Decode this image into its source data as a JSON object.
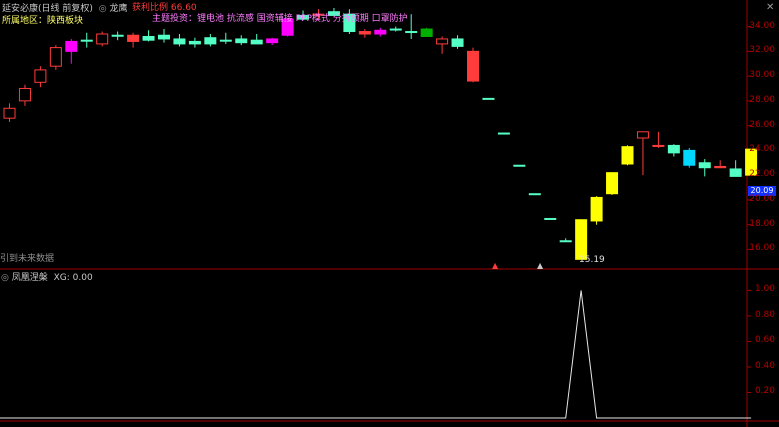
{
  "header": {
    "stock_title": "延安必康(日线 前复权)",
    "indicator_name": "龙鹰",
    "profit_label": "获利比例",
    "profit_value": "66.60",
    "region_label": "所属地区：陕西板块",
    "theme_label": "主题投资：锂电池 抗流感 国资辅接 PPP模式 分拆预期 口罩防护"
  },
  "main_chart": {
    "no_data_text": "引到未来数据",
    "low_label": "15.19",
    "current_price_tag": "20.09",
    "y_ticks": [
      "34.00",
      "32.00",
      "30.00",
      "28.00",
      "26.00",
      "24.00",
      "22.00",
      "20.00",
      "18.00",
      "16.00"
    ],
    "colors": {
      "up": "#ff3c3c",
      "down": "#54ffc6",
      "magenta": "#ff00ff",
      "yellow": "#ffff00",
      "cyan": "#00d8ff",
      "green": "#00b000"
    }
  },
  "indicator": {
    "title": "凤凰涅槃",
    "value_text": "XG: 0.00",
    "y_ticks": [
      "1.00",
      "0.80",
      "0.60",
      "0.40",
      "0.20"
    ]
  },
  "chart_data": [
    {
      "type": "candlestick",
      "title": "延安必康(日线 前复权)",
      "ylim": [
        14.5,
        35.5
      ],
      "candles": [
        {
          "o": 26.6,
          "h": 27.8,
          "l": 26.3,
          "c": 27.4,
          "color": "up"
        },
        {
          "o": 28.0,
          "h": 29.3,
          "l": 27.6,
          "c": 29.0,
          "color": "up"
        },
        {
          "o": 29.5,
          "h": 30.8,
          "l": 29.1,
          "c": 30.5,
          "color": "up"
        },
        {
          "o": 30.8,
          "h": 32.5,
          "l": 30.5,
          "c": 32.3,
          "color": "up"
        },
        {
          "o": 32.0,
          "h": 33.0,
          "l": 31.0,
          "c": 32.8,
          "color": "magenta"
        },
        {
          "o": 32.9,
          "h": 33.5,
          "l": 32.3,
          "c": 32.9,
          "color": "down"
        },
        {
          "o": 32.6,
          "h": 33.6,
          "l": 32.4,
          "c": 33.4,
          "color": "up"
        },
        {
          "o": 33.3,
          "h": 33.6,
          "l": 32.9,
          "c": 33.3,
          "color": "down"
        },
        {
          "o": 33.3,
          "h": 33.5,
          "l": 32.3,
          "c": 32.8,
          "color": "up"
        },
        {
          "o": 33.2,
          "h": 33.7,
          "l": 32.8,
          "c": 32.9,
          "color": "down"
        },
        {
          "o": 33.3,
          "h": 33.8,
          "l": 32.7,
          "c": 33.0,
          "color": "down"
        },
        {
          "o": 33.0,
          "h": 33.4,
          "l": 32.4,
          "c": 32.6,
          "color": "down"
        },
        {
          "o": 32.8,
          "h": 33.1,
          "l": 32.3,
          "c": 32.6,
          "color": "down"
        },
        {
          "o": 33.1,
          "h": 33.4,
          "l": 32.4,
          "c": 32.6,
          "color": "down"
        },
        {
          "o": 32.9,
          "h": 33.5,
          "l": 32.6,
          "c": 32.9,
          "color": "down"
        },
        {
          "o": 33.0,
          "h": 33.3,
          "l": 32.5,
          "c": 32.7,
          "color": "down"
        },
        {
          "o": 32.9,
          "h": 33.4,
          "l": 32.6,
          "c": 32.6,
          "color": "down"
        },
        {
          "o": 32.7,
          "h": 33.1,
          "l": 32.5,
          "c": 33.0,
          "color": "magenta"
        },
        {
          "o": 33.3,
          "h": 34.7,
          "l": 33.2,
          "c": 34.6,
          "color": "magenta"
        },
        {
          "o": 34.9,
          "h": 35.3,
          "l": 34.5,
          "c": 34.6,
          "color": "down"
        },
        {
          "o": 35.0,
          "h": 35.4,
          "l": 34.6,
          "c": 35.0,
          "color": "up"
        },
        {
          "o": 35.2,
          "h": 35.5,
          "l": 34.9,
          "c": 34.9,
          "color": "down"
        },
        {
          "o": 35.0,
          "h": 35.4,
          "l": 33.4,
          "c": 33.6,
          "color": "down"
        },
        {
          "o": 33.6,
          "h": 33.8,
          "l": 33.1,
          "c": 33.4,
          "color": "up"
        },
        {
          "o": 33.7,
          "h": 33.9,
          "l": 33.2,
          "c": 33.4,
          "color": "magenta"
        },
        {
          "o": 33.8,
          "h": 34.0,
          "l": 33.6,
          "c": 33.8,
          "color": "down"
        },
        {
          "o": 33.6,
          "h": 35.0,
          "l": 33.0,
          "c": 33.6,
          "color": "down"
        },
        {
          "o": 33.8,
          "h": 33.9,
          "l": 33.2,
          "c": 33.2,
          "color": "green"
        },
        {
          "o": 32.6,
          "h": 33.2,
          "l": 31.8,
          "c": 33.0,
          "color": "up"
        },
        {
          "o": 33.0,
          "h": 33.3,
          "l": 32.2,
          "c": 32.4,
          "color": "down"
        },
        {
          "o": 32.0,
          "h": 32.3,
          "l": 29.5,
          "c": 29.6,
          "color": "up"
        },
        {
          "o": 28.2,
          "h": 28.2,
          "l": 28.2,
          "c": 28.2,
          "color": "down"
        },
        {
          "o": 25.4,
          "h": 25.4,
          "l": 25.4,
          "c": 25.4,
          "color": "down"
        },
        {
          "o": 22.8,
          "h": 22.8,
          "l": 22.8,
          "c": 22.8,
          "color": "down"
        },
        {
          "o": 20.5,
          "h": 20.5,
          "l": 20.5,
          "c": 20.5,
          "color": "down"
        },
        {
          "o": 18.5,
          "h": 18.5,
          "l": 18.5,
          "c": 18.5,
          "color": "down"
        },
        {
          "o": 16.7,
          "h": 16.9,
          "l": 16.6,
          "c": 16.7,
          "color": "down"
        },
        {
          "o": 15.2,
          "h": 18.4,
          "l": 15.19,
          "c": 18.4,
          "color": "yellow"
        },
        {
          "o": 18.3,
          "h": 20.3,
          "l": 18.0,
          "c": 20.2,
          "color": "yellow"
        },
        {
          "o": 20.5,
          "h": 22.2,
          "l": 20.4,
          "c": 22.2,
          "color": "yellow"
        },
        {
          "o": 22.9,
          "h": 24.4,
          "l": 22.8,
          "c": 24.3,
          "color": "yellow"
        },
        {
          "o": 25.0,
          "h": 25.4,
          "l": 22.0,
          "c": 25.5,
          "color": "up"
        },
        {
          "o": 24.4,
          "h": 25.5,
          "l": 24.2,
          "c": 24.4,
          "color": "up"
        },
        {
          "o": 24.4,
          "h": 24.5,
          "l": 23.5,
          "c": 23.8,
          "color": "down"
        },
        {
          "o": 24.0,
          "h": 24.2,
          "l": 22.6,
          "c": 22.8,
          "color": "cyan"
        },
        {
          "o": 23.0,
          "h": 23.3,
          "l": 21.9,
          "c": 22.6,
          "color": "down"
        },
        {
          "o": 22.7,
          "h": 23.2,
          "l": 22.6,
          "c": 22.6,
          "color": "up"
        },
        {
          "o": 22.5,
          "h": 23.2,
          "l": 21.9,
          "c": 21.9,
          "color": "down"
        },
        {
          "o": 22.0,
          "h": 24.1,
          "l": 22.0,
          "c": 24.1,
          "color": "yellow"
        }
      ]
    },
    {
      "type": "line",
      "title": "凤凰涅槃",
      "ylim": [
        0,
        1.05
      ],
      "y": [
        0,
        0,
        0,
        0,
        0,
        0,
        0,
        0,
        0,
        0,
        0,
        0,
        0,
        0,
        0,
        0,
        0,
        0,
        0,
        0,
        0,
        0,
        0,
        0,
        0,
        0,
        0,
        0,
        0,
        0,
        0,
        0,
        0,
        0,
        0,
        0,
        0,
        1,
        0,
        0,
        0,
        0,
        0,
        0,
        0,
        0,
        0,
        0,
        0
      ]
    }
  ]
}
